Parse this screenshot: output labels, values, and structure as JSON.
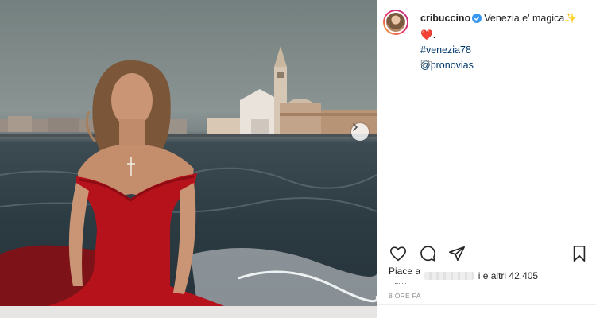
{
  "post": {
    "username": "cribuccino",
    "caption": "Venezia e' magica",
    "caption_emoji": "✨❤️.",
    "hashtag": "#venezia78",
    "mention": "@pronovias",
    "time_short": "8 h",
    "time_upper": "8 ORE FA"
  },
  "likes": {
    "prefix": "Piace a",
    "suffix": "i e altri 42.405"
  },
  "icons": [
    "verified-icon",
    "heart-icon",
    "comment-icon",
    "share-icon",
    "bookmark-icon",
    "chevron-right-icon"
  ],
  "colors": {
    "verified": "#3897f0",
    "link": "#00376b",
    "muted": "#8e8e8e",
    "dress_red": "#b5121b"
  }
}
